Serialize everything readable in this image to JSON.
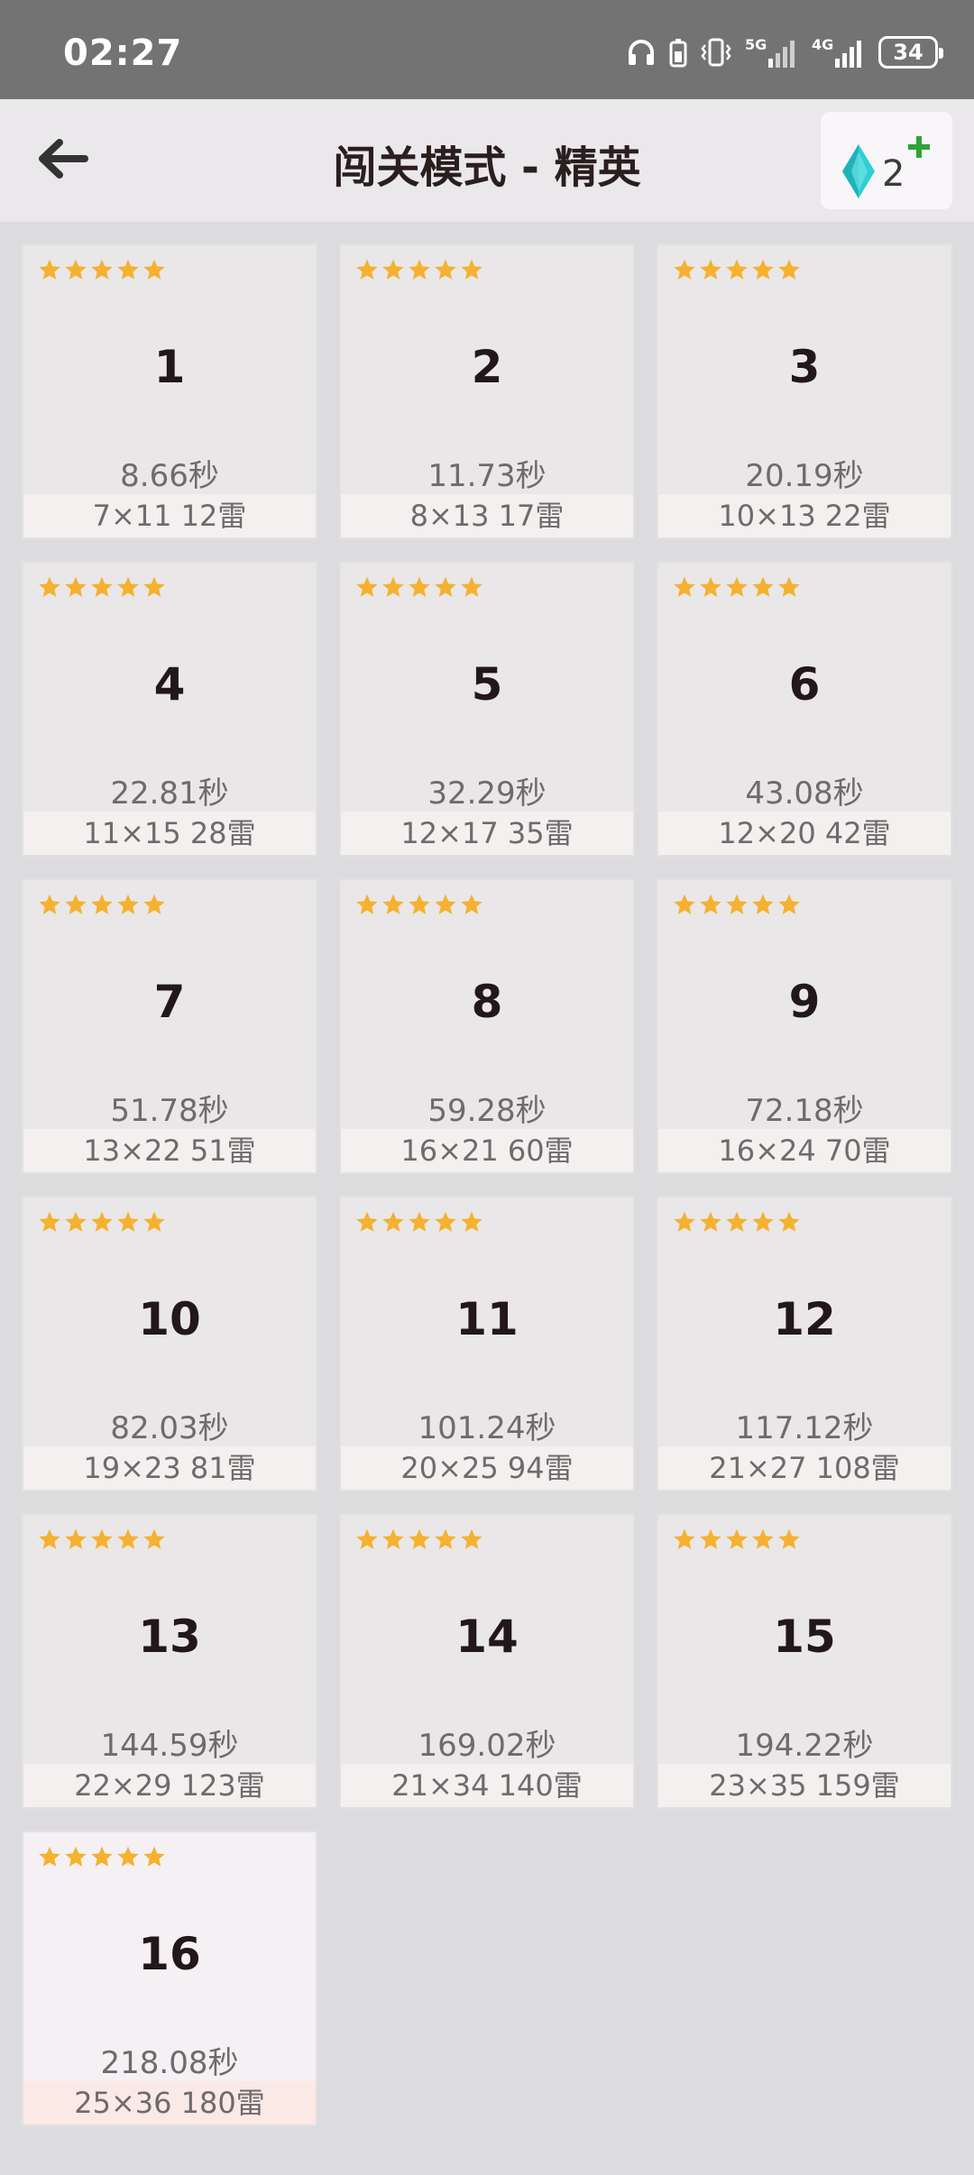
{
  "status_bar": {
    "time": "02:27",
    "battery": "34",
    "network_1": "5G",
    "network_2": "4G",
    "icons": [
      "headphones-icon",
      "battery-saver-icon",
      "vibrate-icon",
      "signal-5g-icon",
      "signal-4g-icon",
      "battery-icon"
    ]
  },
  "header": {
    "title": "闯关模式 - 精英",
    "back_icon": "arrow-left-icon",
    "gem_count": "2",
    "gem_icon": "diamond-icon",
    "add_icon": "plus-icon"
  },
  "colors": {
    "star": "#f5b12f",
    "gem": "#2ecfd3",
    "plus": "#2fa23a",
    "selected_card": "#f4f0f4"
  },
  "levels": [
    {
      "number": "1",
      "stars": 5,
      "time": "8.66秒",
      "info": "7×11  12雷"
    },
    {
      "number": "2",
      "stars": 5,
      "time": "11.73秒",
      "info": "8×13  17雷"
    },
    {
      "number": "3",
      "stars": 5,
      "time": "20.19秒",
      "info": "10×13  22雷"
    },
    {
      "number": "4",
      "stars": 5,
      "time": "22.81秒",
      "info": "11×15  28雷"
    },
    {
      "number": "5",
      "stars": 5,
      "time": "32.29秒",
      "info": "12×17  35雷"
    },
    {
      "number": "6",
      "stars": 5,
      "time": "43.08秒",
      "info": "12×20  42雷"
    },
    {
      "number": "7",
      "stars": 5,
      "time": "51.78秒",
      "info": "13×22  51雷"
    },
    {
      "number": "8",
      "stars": 5,
      "time": "59.28秒",
      "info": "16×21  60雷"
    },
    {
      "number": "9",
      "stars": 5,
      "time": "72.18秒",
      "info": "16×24  70雷"
    },
    {
      "number": "10",
      "stars": 5,
      "time": "82.03秒",
      "info": "19×23  81雷"
    },
    {
      "number": "11",
      "stars": 5,
      "time": "101.24秒",
      "info": "20×25  94雷"
    },
    {
      "number": "12",
      "stars": 5,
      "time": "117.12秒",
      "info": "21×27  108雷"
    },
    {
      "number": "13",
      "stars": 5,
      "time": "144.59秒",
      "info": "22×29  123雷"
    },
    {
      "number": "14",
      "stars": 5,
      "time": "169.02秒",
      "info": "21×34  140雷"
    },
    {
      "number": "15",
      "stars": 5,
      "time": "194.22秒",
      "info": "23×35  159雷"
    },
    {
      "number": "16",
      "stars": 5,
      "time": "218.08秒",
      "info": "25×36  180雷",
      "selected": true
    }
  ]
}
